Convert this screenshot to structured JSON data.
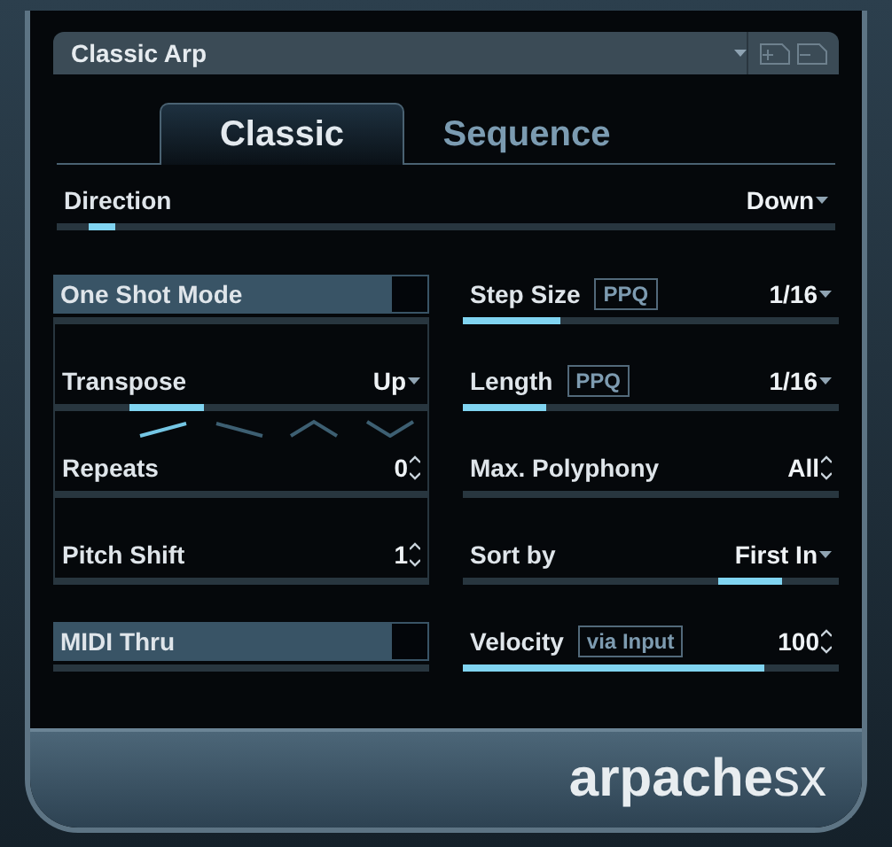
{
  "preset": {
    "name": "Classic Arp"
  },
  "tabs": [
    {
      "label": "Classic",
      "selected": true
    },
    {
      "label": "Sequence",
      "selected": false
    }
  ],
  "direction": {
    "label": "Direction",
    "value": "Down",
    "level": 0.075
  },
  "left_rows": [
    {
      "kind": "toggle",
      "label": "One Shot Mode",
      "on": false
    },
    {
      "kind": "selector",
      "label": "Transpose",
      "value": "Up",
      "patterns": [
        {
          "kind": "up",
          "selected": true
        },
        {
          "kind": "down",
          "selected": false
        },
        {
          "kind": "updown",
          "selected": false
        },
        {
          "kind": "downup",
          "selected": false
        }
      ]
    },
    {
      "kind": "spinner",
      "label": "Repeats",
      "value": "0"
    },
    {
      "kind": "spinner",
      "label": "Pitch Shift",
      "value": "1"
    },
    {
      "kind": "toggle",
      "label": "MIDI Thru",
      "on": false
    }
  ],
  "right_rows": [
    {
      "kind": "fill",
      "label": "Step Size",
      "badge": "PPQ",
      "value": "1/16",
      "spinner": false,
      "level": 0.26
    },
    {
      "kind": "fill",
      "label": "Length",
      "badge": "PPQ",
      "value": "1/16",
      "spinner": false,
      "level": 0.22
    },
    {
      "kind": "plain",
      "label": "Max. Polyphony",
      "value": "All",
      "spinner": true
    },
    {
      "kind": "marker",
      "label": "Sort by",
      "value": "First In",
      "spinner": false,
      "level": 0.85
    },
    {
      "kind": "fill",
      "label": "Velocity",
      "badge": "via Input",
      "value": "100",
      "spinner": true,
      "level": 0.8
    }
  ],
  "logo": "**arpache**sx"
}
